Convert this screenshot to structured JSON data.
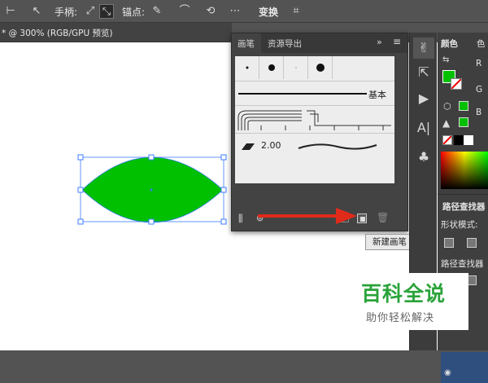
{
  "toolbar": {
    "handle_label": "手柄:",
    "anchor_label": "锚点:",
    "transform_label": "变换"
  },
  "document_tab": {
    "title": "* @ 300% (RGB/GPU 预览)"
  },
  "brush_panel": {
    "tabs": [
      "画笔",
      "资源导出"
    ],
    "basic_label": "基本",
    "stroke_value": "2.00"
  },
  "tooltip": {
    "text": "新建画笔"
  },
  "color_panel": {
    "tab_label": "颜色",
    "tab_label2": "色",
    "r_label": "R",
    "g_label": "G",
    "b_label": "B",
    "fill_color": "#00c000"
  },
  "pathfinder": {
    "title": "路径查找器",
    "shape_modes": "形状模式:",
    "pathfinder_label": "路径查找器"
  },
  "shape": {
    "fill": "#00c000",
    "stroke": "#3d7cff"
  },
  "watermark": {
    "title": "百科全说",
    "subtitle": "助你轻松解决"
  }
}
